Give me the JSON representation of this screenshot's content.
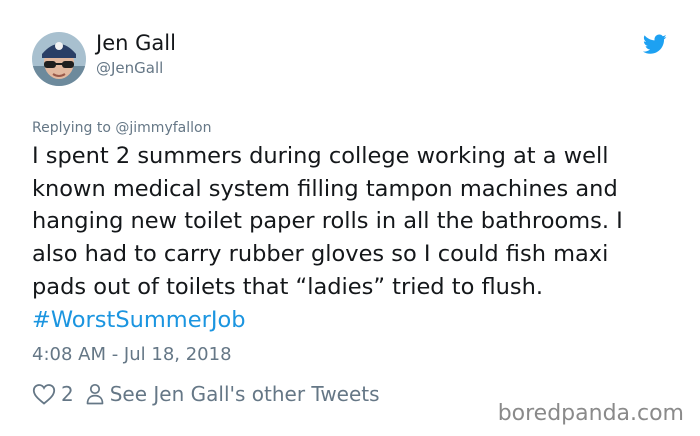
{
  "tweet": {
    "author": {
      "display_name": "Jen Gall",
      "handle": "@JenGall"
    },
    "reply_prefix": "Replying to",
    "reply_mention": "@jimmyfallon",
    "text_lines": [
      "I spent 2 summers during college working at a well",
      "known medical system filling tampon machines and",
      "hanging new toilet paper rolls in all the bathrooms. I",
      "also had to carry rubber gloves so I could fish maxi",
      "pads out of toilets that “ladies” tried to flush."
    ],
    "hashtag": "#WorstSummerJob",
    "timestamp": "4:08 AM - Jul 18, 2018",
    "like_count": "2",
    "see_more_link": "See Jen Gall's other Tweets"
  },
  "watermark": "boredpanda.com",
  "icons": {
    "brand": "twitter-bird-icon",
    "like": "heart-outline-icon",
    "profile": "person-outline-icon"
  },
  "colors": {
    "text": "#14171a",
    "secondary": "#657786",
    "link": "#1b95e0",
    "brand": "#1da1f2"
  }
}
